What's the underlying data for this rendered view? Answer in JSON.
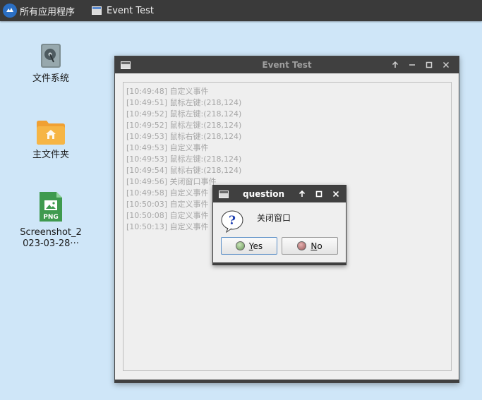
{
  "taskbar": {
    "menu_label": "所有应用程序",
    "task_label": "Event Test"
  },
  "desktop": {
    "icons": [
      {
        "label": "文件系统",
        "icon": "filesystem-icon"
      },
      {
        "label": "主文件夹",
        "icon": "home-folder-icon"
      },
      {
        "label": "Screenshot_2\n023-03-28···",
        "icon": "png-file-icon",
        "badge": "PNG"
      }
    ]
  },
  "window": {
    "title": "Event Test",
    "log_lines": [
      "[10:49:48] 自定义事件",
      "[10:49:51] 鼠标左键:(218,124)",
      "[10:49:52] 鼠标左键:(218,124)",
      "[10:49:52] 鼠标左键:(218,124)",
      "[10:49:53] 鼠标右键:(218,124)",
      "[10:49:53] 自定义事件",
      "[10:49:53] 鼠标左键:(218,124)",
      "[10:49:54] 鼠标右键:(218,124)",
      "[10:49:56] 关闭窗口事件",
      "[10:49:58] 自定义事件",
      "[10:50:03] 自定义事件",
      "[10:50:08] 自定义事件",
      "[10:50:13] 自定义事件"
    ]
  },
  "dialog": {
    "title": "question",
    "message": "关闭窗口",
    "yes_label": "es",
    "yes_mnemonic": "Y",
    "no_label": "o",
    "no_mnemonic": "N"
  },
  "colors": {
    "desktop_bg": "#cfe6f8",
    "titlebar": "#404040",
    "log_text": "#a6a6a6"
  }
}
